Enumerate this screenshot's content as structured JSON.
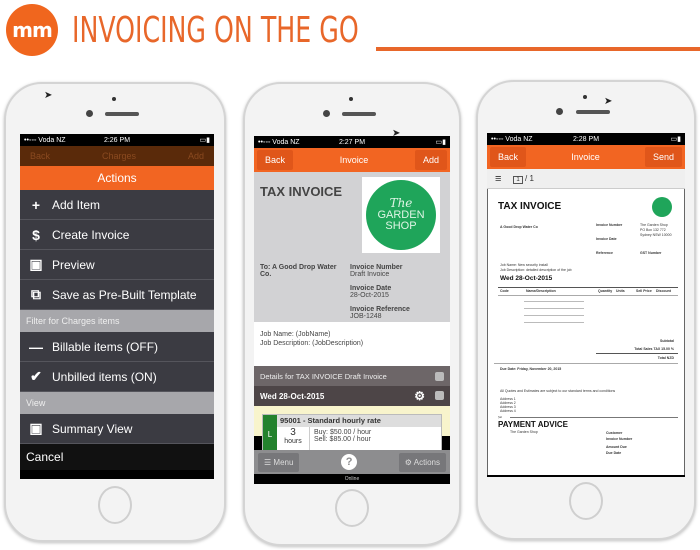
{
  "header": {
    "logo_text": "m",
    "title": "INVOICING ON THE GO",
    "brand_color": "#f0661e"
  },
  "phone1": {
    "status": {
      "carrier": "••◦◦◦ Voda NZ",
      "time": "2:26 PM"
    },
    "nav": {
      "back": "Back",
      "title": "Charges",
      "add": "Add"
    },
    "actions_title": "Actions",
    "items": [
      {
        "icon": "plus-icon",
        "glyph": "+",
        "label": "Add Item"
      },
      {
        "icon": "dollar-icon",
        "glyph": "$",
        "label": "Create Invoice"
      },
      {
        "icon": "preview-icon",
        "glyph": "▣",
        "label": "Preview"
      },
      {
        "icon": "template-icon",
        "glyph": "⧉",
        "label": "Save as Pre-Built Template"
      }
    ],
    "filter_section": "Filter for Charges items",
    "filters": [
      {
        "icon": "dash-icon",
        "glyph": "—",
        "label": "Billable items (OFF)"
      },
      {
        "icon": "check-icon",
        "glyph": "✔",
        "label": "Unbilled items (ON)"
      }
    ],
    "view_section": "View",
    "view_items": [
      {
        "icon": "summary-view-icon",
        "glyph": "▣",
        "label": "Summary View"
      }
    ],
    "cancel": "Cancel"
  },
  "phone2": {
    "status": {
      "carrier": "••◦◦◦ Voda NZ",
      "time": "2:27 PM"
    },
    "nav": {
      "back": "Back",
      "title": "Invoice",
      "add": "Add"
    },
    "doc_title": "TAX INVOICE",
    "logo": {
      "line1": "The",
      "line2": "GARDEN",
      "line3": "SHOP"
    },
    "to": "To: A Good Drop Water Co.",
    "invoice_number_label": "Invoice Number",
    "invoice_number": "Draft Invoice",
    "invoice_date_label": "Invoice Date",
    "invoice_date": "28-Oct-2015",
    "invoice_reference_label": "Invoice Reference",
    "invoice_reference": "JOB-1248",
    "job_name": "Job Name: (JobName)",
    "job_description": "Job Description: (JobDescription)",
    "details_bar": "Details for TAX INVOICE Draft Invoice",
    "date_bar": "Wed 28-Oct-2015",
    "charge": {
      "type": "L",
      "title": "95001 - Standard hourly rate",
      "qty": "3",
      "unit": "hours",
      "buy": "Buy: $50.00 / hour",
      "sell": "Sell: $85.00 / hour"
    },
    "toolbar": {
      "menu": "Menu",
      "help": "?",
      "actions": "Actions"
    },
    "online": "Online"
  },
  "phone3": {
    "status": {
      "carrier": "••◦◦◦ Voda NZ",
      "time": "2:28 PM"
    },
    "nav": {
      "back": "Back",
      "title": "Invoice",
      "send": "Send"
    },
    "toolbar": {
      "menu_glyph": "≡",
      "page_current": "1",
      "page_total": "/ 1"
    },
    "doc_title": "TAX INVOICE",
    "customer": "A Good Drop Water Co",
    "labels": {
      "invoice_number": "Invoice Number",
      "invoice_date": "Invoice Date",
      "reference": "Reference",
      "gst_number": "GST Number"
    },
    "company": [
      "The Garden Shop",
      "PO Box 132 772",
      "Sydney NSW 10000"
    ],
    "job_lines": [
      "Job Name: New security install",
      "Job Description: detailed description of the job"
    ],
    "date_heading": "Wed 28-Oct-2015",
    "columns": [
      "Code",
      "Name/Description",
      "Quantity",
      "Units",
      "Sell Price",
      "Discount"
    ],
    "totals": [
      "Subtotal",
      "Total Sales TAX 15.00 %",
      "Total NZD"
    ],
    "due_date": "Due Date: Friday, November 20, 2015",
    "terms": "All Quotes and Estimates are subject to our standard terms and conditions",
    "address": [
      "Address 1",
      "Address 2",
      "Address 3",
      "Address 4"
    ],
    "payment_advice": "PAYMENT ADVICE",
    "payment_labels": [
      "Customer",
      "Invoice Number",
      "Amount Due",
      "Due Date"
    ]
  }
}
